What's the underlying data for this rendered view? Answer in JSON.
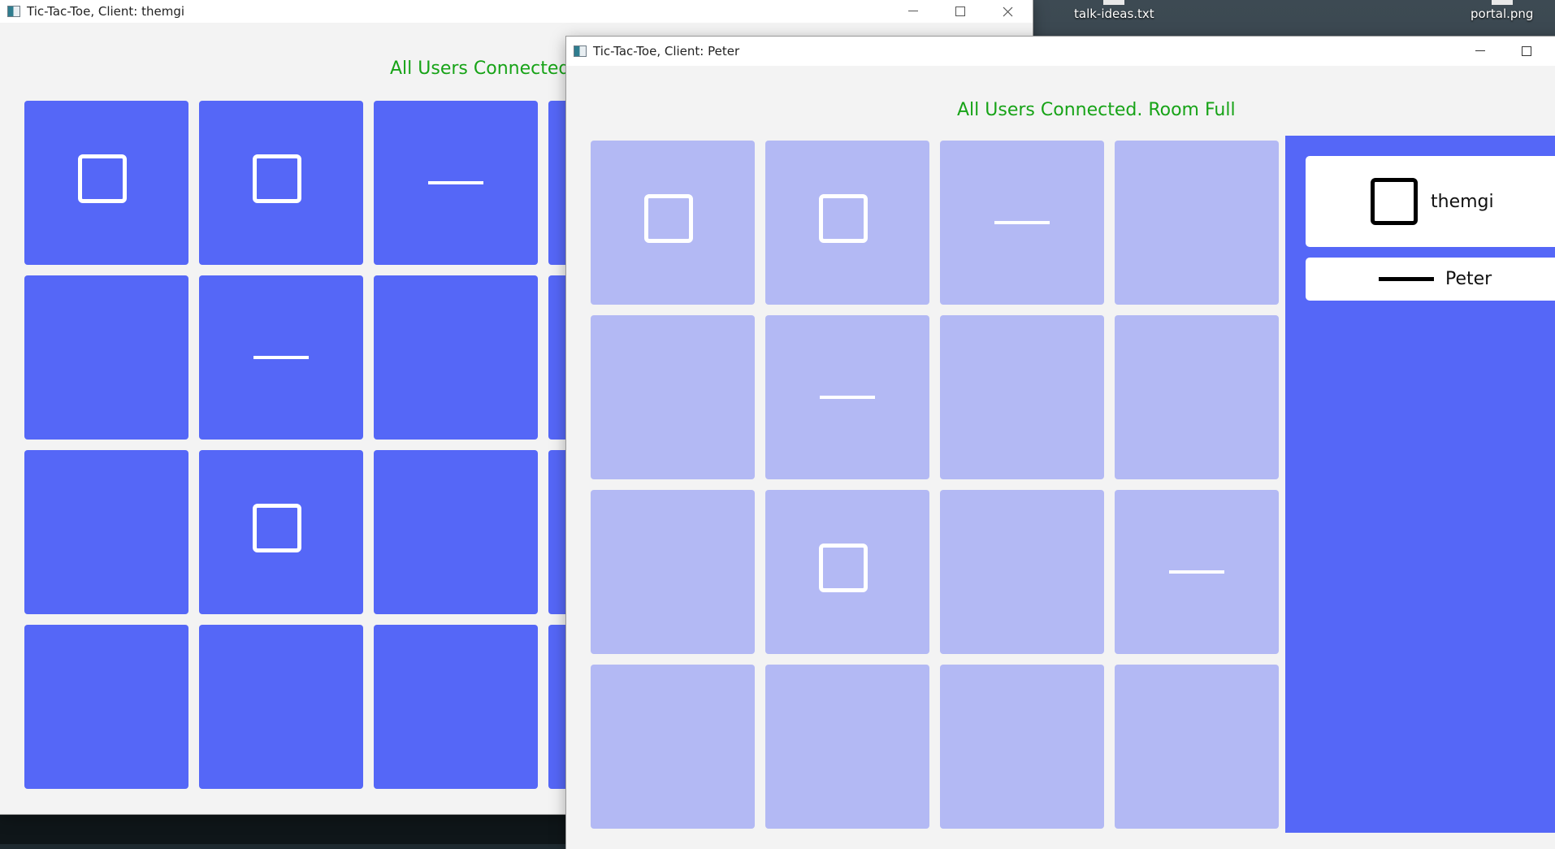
{
  "desktop": {
    "files": [
      {
        "label": "talk-ideas.txt"
      },
      {
        "label": "portal.png"
      }
    ]
  },
  "window1": {
    "title": "Tic-Tac-Toe, Client: themgi",
    "status": "All Users Connected. Room Full",
    "board": [
      [
        "square",
        "square",
        "dash",
        "empty"
      ],
      [
        "empty",
        "dash",
        "empty",
        "empty"
      ],
      [
        "empty",
        "square",
        "empty",
        "empty"
      ],
      [
        "empty",
        "empty",
        "empty",
        "empty"
      ]
    ]
  },
  "window2": {
    "title": "Tic-Tac-Toe, Client: Peter",
    "status": "All Users Connected. Room Full",
    "board": [
      [
        "square",
        "square",
        "dash",
        "empty"
      ],
      [
        "empty",
        "dash",
        "empty",
        "empty"
      ],
      [
        "empty",
        "square",
        "empty",
        "dash"
      ],
      [
        "empty",
        "empty",
        "empty",
        "empty"
      ]
    ],
    "players": [
      {
        "name": "themgi",
        "symbol": "square"
      },
      {
        "name": "Peter",
        "symbol": "dash"
      }
    ]
  },
  "colors": {
    "tile_active": "#5567f7",
    "tile_disabled": "#b3b9f4",
    "status_text": "#17a317"
  }
}
